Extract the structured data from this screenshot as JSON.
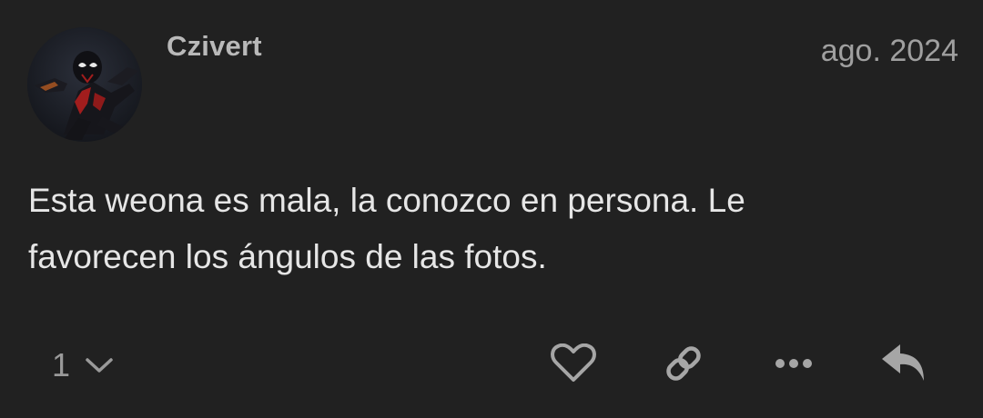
{
  "post": {
    "author": "Czivert",
    "date": "ago. 2024",
    "body_lines": [
      "Esta weona es mala, la conozco en persona. Le",
      "favorecen los ángulos de las fotos."
    ]
  },
  "actions": {
    "reply_count": "1",
    "icons": [
      "chevron-down-icon",
      "heart-icon",
      "link-icon",
      "more-icon",
      "reply-icon"
    ]
  },
  "colors": {
    "background": "#212121",
    "text": "#e6e6e6",
    "muted": "#9a9a9a"
  }
}
